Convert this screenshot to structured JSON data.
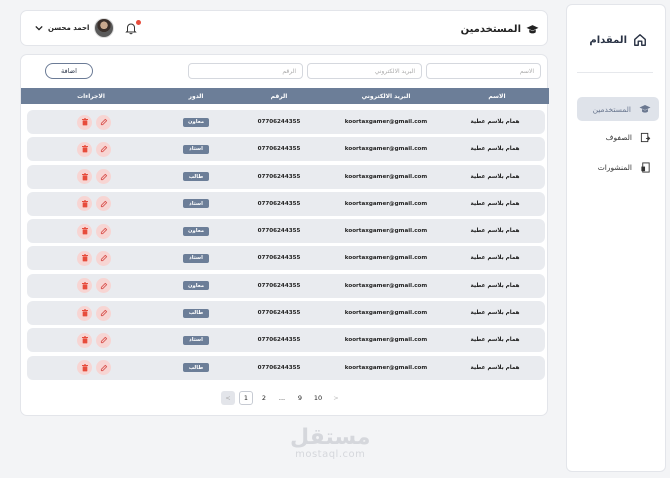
{
  "sidebar": {
    "brand": "المقدام",
    "items": [
      {
        "label": "المستخدمين",
        "icon": "graduation-cap-icon",
        "active": true
      },
      {
        "label": "الصفوف",
        "icon": "classes-icon",
        "active": false
      },
      {
        "label": "المنشورات",
        "icon": "posts-icon",
        "active": false
      }
    ]
  },
  "header": {
    "title": "المستخدمين",
    "user_name": "احمد محسن"
  },
  "filters": {
    "name_placeholder": "الاسم",
    "email_placeholder": "البريد الالكتروني",
    "phone_placeholder": "الرقم"
  },
  "add_button": "اضافة",
  "table": {
    "columns": [
      "الاسم",
      "البريد الالكتروني",
      "الرقم",
      "الدور",
      "الاجراءات"
    ],
    "rows": [
      {
        "name": "همام بلاسم عطية",
        "email": "koortaxgamer@gmail.com",
        "phone": "07706244355",
        "role": "معاون"
      },
      {
        "name": "همام بلاسم عطية",
        "email": "koortaxgamer@gmail.com",
        "phone": "07706244355",
        "role": "استاذ"
      },
      {
        "name": "همام بلاسم عطية",
        "email": "koortaxgamer@gmail.com",
        "phone": "07706244355",
        "role": "طالب"
      },
      {
        "name": "همام بلاسم عطية",
        "email": "koortaxgamer@gmail.com",
        "phone": "07706244355",
        "role": "استاذ"
      },
      {
        "name": "همام بلاسم عطية",
        "email": "koortaxgamer@gmail.com",
        "phone": "07706244355",
        "role": "معاون"
      },
      {
        "name": "همام بلاسم عطية",
        "email": "koortaxgamer@gmail.com",
        "phone": "07706244355",
        "role": "استاذ"
      },
      {
        "name": "همام بلاسم عطية",
        "email": "koortaxgamer@gmail.com",
        "phone": "07706244355",
        "role": "معاون"
      },
      {
        "name": "همام بلاسم عطية",
        "email": "koortaxgamer@gmail.com",
        "phone": "07706244355",
        "role": "طالب"
      },
      {
        "name": "همام بلاسم عطية",
        "email": "koortaxgamer@gmail.com",
        "phone": "07706244355",
        "role": "استاذ"
      },
      {
        "name": "همام بلاسم عطية",
        "email": "koortaxgamer@gmail.com",
        "phone": "07706244355",
        "role": "طالب"
      }
    ]
  },
  "pagination": {
    "items": [
      "<",
      "1",
      "2",
      "...",
      "9",
      "10",
      ">"
    ]
  },
  "watermark": {
    "logo": "مستقل",
    "site": "mostaql.com"
  },
  "colors": {
    "accent": "#6c7e98",
    "action_bg": "#f7d5d3",
    "delete": "#e74c3c",
    "edit": "#d9534f"
  }
}
